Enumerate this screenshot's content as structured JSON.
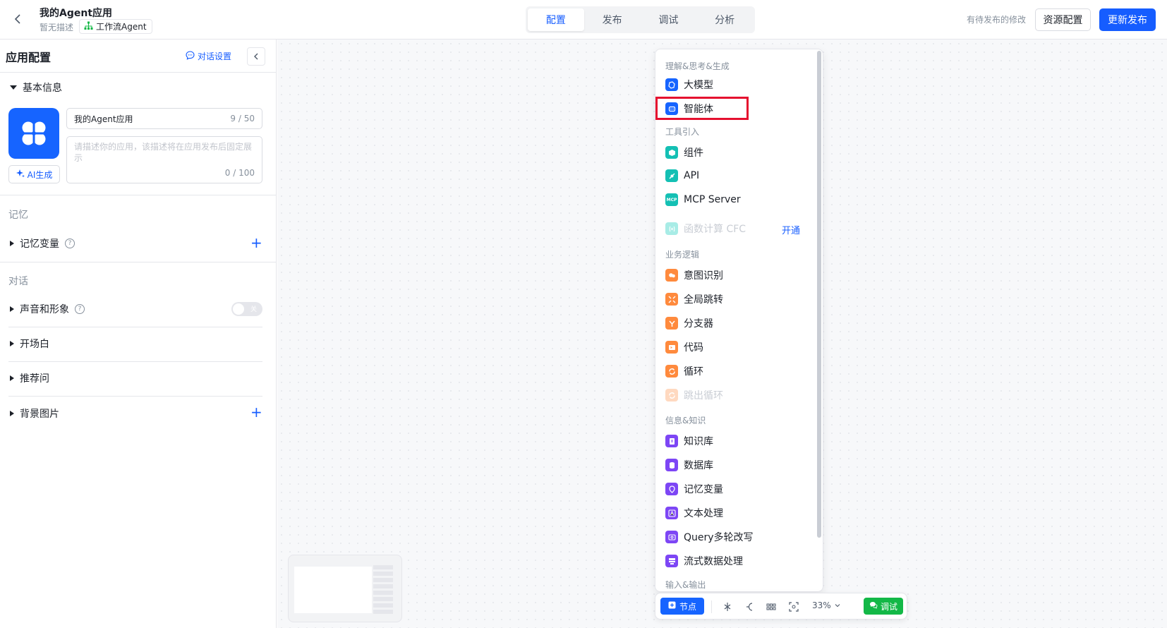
{
  "topbar": {
    "app_title": "我的Agent应用",
    "app_desc": "暂无描述",
    "app_type": "工作流Agent",
    "tabs": [
      "配置",
      "发布",
      "调试",
      "分析"
    ],
    "active_tab": "配置",
    "pending_text": "有待发布的修改",
    "resource_btn": "资源配置",
    "publish_btn": "更新发布"
  },
  "left": {
    "title": "应用配置",
    "chat_settings": "对话设置",
    "basic_info": "基本信息",
    "name_value": "我的Agent应用",
    "name_count": "9 / 50",
    "desc_placeholder": "请描述你的应用，该描述将在应用发布后固定展示",
    "desc_count": "0 / 100",
    "ai_btn": "AI生成",
    "memory_group": "记忆",
    "memory_var": "记忆变量",
    "chat_group": "对话",
    "voice": "声音和形象",
    "toggle_off": "关",
    "opening": "开场白",
    "suggestions": "推荐问",
    "background": "背景图片"
  },
  "menu": {
    "cat_understand": "理解&思考&生成",
    "llm": "大模型",
    "agent": "智能体",
    "cat_tools": "工具引入",
    "component": "组件",
    "api": "API",
    "mcp": "MCP Server",
    "mcp_icon_text": "MCP",
    "cfc": "函数计算 CFC",
    "cfc_open": "开通",
    "cat_logic": "业务逻辑",
    "intent": "意图识别",
    "global_jump": "全局跳转",
    "branch": "分支器",
    "code": "代码",
    "loop": "循环",
    "break_loop": "跳出循环",
    "cat_info": "信息&知识",
    "kb": "知识库",
    "db": "数据库",
    "mem_var": "记忆变量",
    "text_proc": "文本处理",
    "query_rewrite": "Query多轮改写",
    "stream": "流式数据处理",
    "cat_io": "输入&输出"
  },
  "toolbar": {
    "node_btn": "节点",
    "zoom": "33%",
    "debug_btn": "调试"
  },
  "colors": {
    "primary": "#165dff",
    "highlight": "#e5102f",
    "debug_green": "#13b847"
  }
}
